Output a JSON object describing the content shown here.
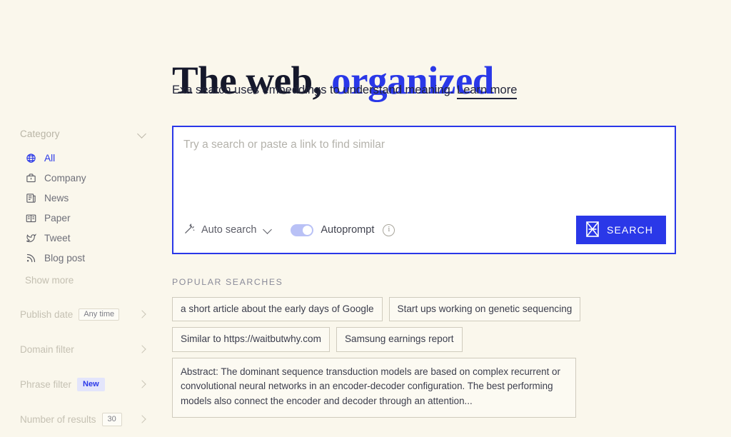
{
  "theme": {
    "background": "#faf7ec",
    "accent": "#2a38e8",
    "panel": "#ffffff",
    "muted_text": "#c5c1b3"
  },
  "hero": {
    "title_lead": "The web,",
    "title_accent": "organized",
    "subtitle_text": "Exa search uses embeddings to understand meaning.",
    "learn_more": "Learn more"
  },
  "sidebar": {
    "category": {
      "label": "Category",
      "items": [
        {
          "label": "All",
          "icon": "globe-icon",
          "active": true
        },
        {
          "label": "Company",
          "icon": "briefcase-icon",
          "active": false
        },
        {
          "label": "News",
          "icon": "newspaper-icon",
          "active": false
        },
        {
          "label": "Paper",
          "icon": "book-icon",
          "active": false
        },
        {
          "label": "Tweet",
          "icon": "twitter-bird-icon",
          "active": false
        },
        {
          "label": "Blog post",
          "icon": "rss-icon",
          "active": false
        }
      ],
      "show_more": "Show more"
    },
    "filters": [
      {
        "label": "Publish date",
        "badge": "Any time",
        "badge_style": "plain"
      },
      {
        "label": "Domain filter",
        "badge": "",
        "badge_style": "none"
      },
      {
        "label": "Phrase filter",
        "badge": "New",
        "badge_style": "new"
      },
      {
        "label": "Number of results",
        "badge": "30",
        "badge_style": "num"
      }
    ]
  },
  "search": {
    "placeholder": "Try a search or paste a link to find similar",
    "value": "",
    "auto_search_label": "Auto search",
    "autoprompt_label": "Autoprompt",
    "autoprompt_on": true,
    "search_button_label": "SEARCH"
  },
  "popular": {
    "heading": "POPULAR  SEARCHES",
    "chips": [
      {
        "text": "a short article about the early days of Google",
        "block": false
      },
      {
        "text": "Start ups working on genetic sequencing",
        "block": false
      },
      {
        "text": "Similar to https://waitbutwhy.com",
        "block": false
      },
      {
        "text": "Samsung earnings report",
        "block": false
      },
      {
        "text": "Abstract: The dominant sequence transduction models are based on complex recurrent or convolutional neural networks in an encoder-decoder configuration. The best performing models also connect the encoder and decoder through an attention...",
        "block": true
      }
    ]
  }
}
